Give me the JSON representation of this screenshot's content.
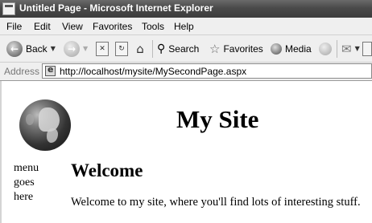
{
  "window": {
    "title": "Untitled Page - Microsoft Internet Explorer"
  },
  "menubar": {
    "items": [
      "File",
      "Edit",
      "View",
      "Favorites",
      "Tools",
      "Help"
    ]
  },
  "toolbar": {
    "back": "Back",
    "search": "Search",
    "favorites": "Favorites",
    "media": "Media"
  },
  "address": {
    "label": "Address",
    "url": "http://localhost/mysite/MySecondPage.aspx"
  },
  "page": {
    "site_title": "My Site",
    "menu_lines": [
      "menu",
      "goes",
      "here"
    ],
    "heading": "Welcome",
    "body_text": "Welcome to my site, where you'll find lots of interesting stuff."
  }
}
